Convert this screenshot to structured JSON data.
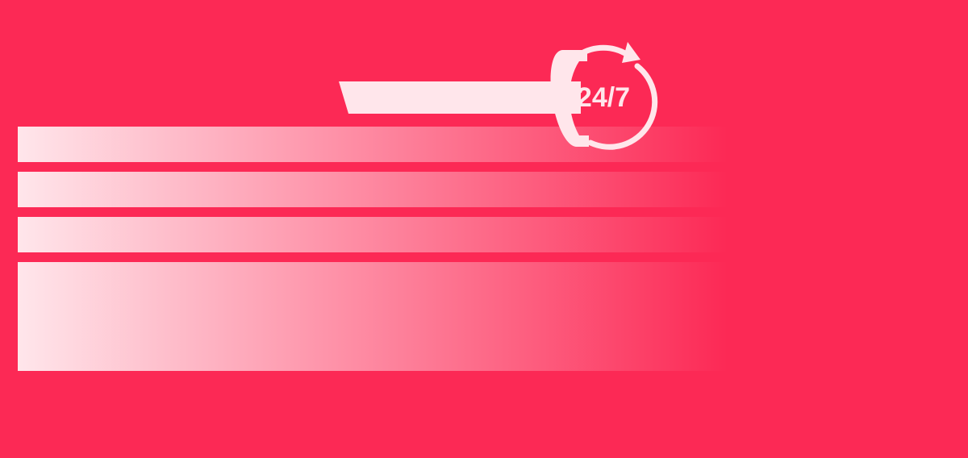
{
  "colors": {
    "background": "#FC2955",
    "highlight": "#FFE6EB"
  },
  "badge": {
    "text": "24/7",
    "icon": "phone-24-7-icon"
  }
}
